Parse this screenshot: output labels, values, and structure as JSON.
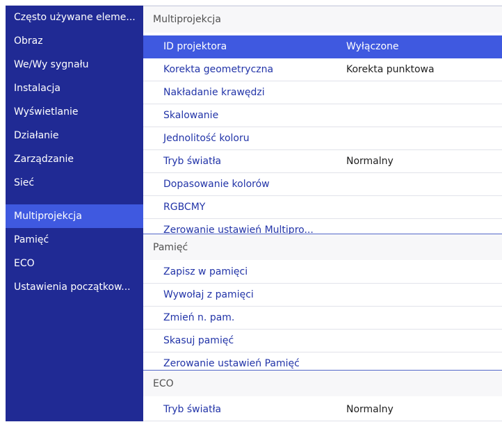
{
  "sidebar": {
    "items": [
      {
        "label": "Często używane eleme..."
      },
      {
        "label": "Obraz"
      },
      {
        "label": "We/Wy sygnału"
      },
      {
        "label": "Instalacja"
      },
      {
        "label": "Wyświetlanie"
      },
      {
        "label": "Działanie"
      },
      {
        "label": "Zarządzanie"
      },
      {
        "label": "Sieć"
      },
      {
        "label": "Multiprojekcja",
        "selected": true
      },
      {
        "label": "Pamięć"
      },
      {
        "label": "ECO"
      },
      {
        "label": "Ustawienia początkow..."
      }
    ]
  },
  "sections": [
    {
      "title": "Multiprojekcja",
      "rows": [
        {
          "label": "ID projektora",
          "value": "Wyłączone",
          "selected": true
        },
        {
          "label": "Korekta geometryczna",
          "value": "Korekta punktowa"
        },
        {
          "label": "Nakładanie krawędzi",
          "value": ""
        },
        {
          "label": "Skalowanie",
          "value": ""
        },
        {
          "label": "Jednolitość koloru",
          "value": ""
        },
        {
          "label": "Tryb światła",
          "value": "Normalny"
        },
        {
          "label": "Dopasowanie kolorów",
          "value": ""
        },
        {
          "label": "RGBCMY",
          "value": ""
        },
        {
          "label": "Zerowanie ustawień Multipro...",
          "value": ""
        }
      ]
    },
    {
      "title": "Pamięć",
      "rows": [
        {
          "label": "Zapisz w pamięci",
          "value": ""
        },
        {
          "label": "Wywołaj z pamięci",
          "value": ""
        },
        {
          "label": "Zmień n. pam.",
          "value": ""
        },
        {
          "label": "Skasuj pamięć",
          "value": ""
        },
        {
          "label": "Zerowanie ustawień Pamięć",
          "value": ""
        }
      ]
    },
    {
      "title": "ECO",
      "rows": [
        {
          "label": "Tryb światła",
          "value": "Normalny"
        }
      ]
    }
  ],
  "colors": {
    "sidebar_bg": "#202a94",
    "selection": "#3f59e0",
    "item_text": "#2234a8"
  }
}
